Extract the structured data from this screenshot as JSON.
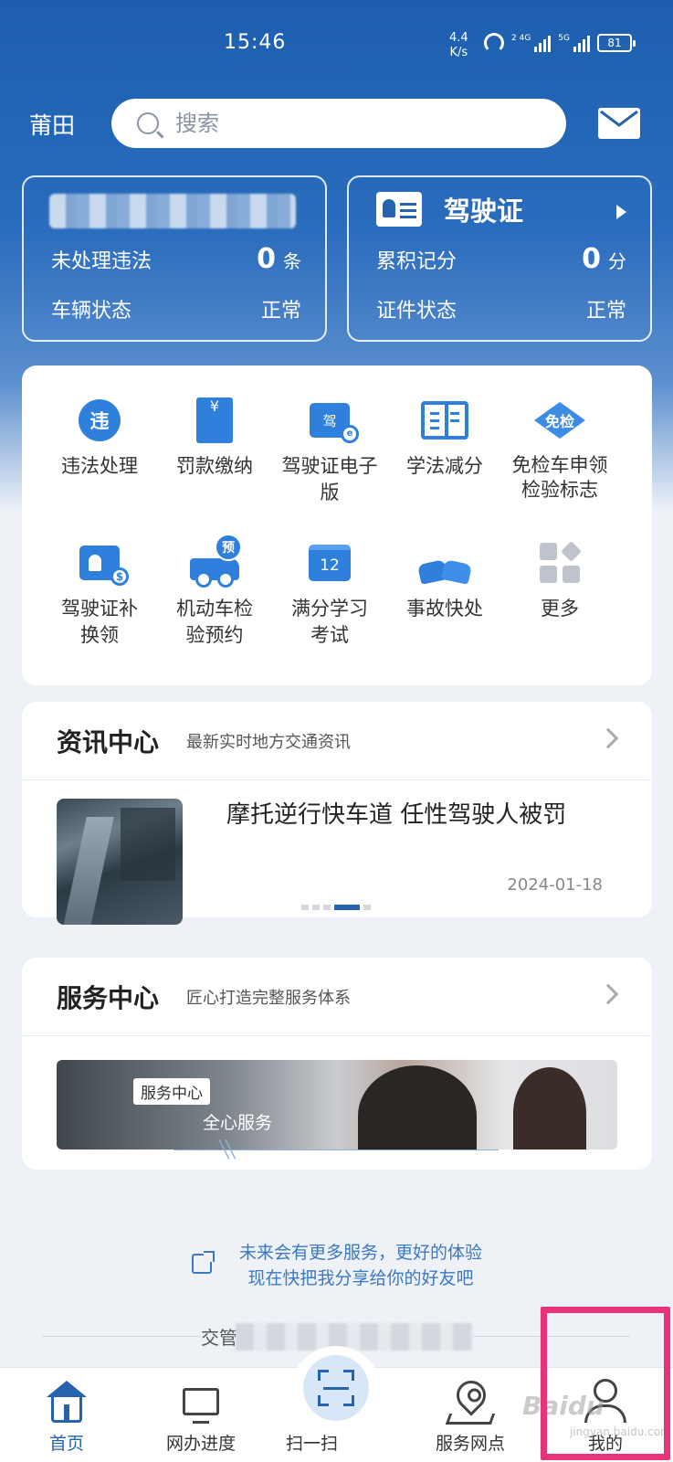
{
  "status_bar": {
    "time": "15:46",
    "speed": "4.4",
    "speed_unit": "K/s",
    "sig1_label": "2 4G",
    "sig2_label": "5G",
    "battery": "81"
  },
  "header": {
    "city": "莆田",
    "search_placeholder": "搜索",
    "mail_icon": "mail-icon"
  },
  "vehicle_card": {
    "violations_label": "未处理违法",
    "violations_count": "0",
    "violations_unit": "条",
    "status_label": "车辆状态",
    "status_value": "正常"
  },
  "license_card": {
    "title": "驾驶证",
    "points_label": "累积记分",
    "points_value": "0",
    "points_unit": "分",
    "status_label": "证件状态",
    "status_value": "正常"
  },
  "services": {
    "items": [
      {
        "label": "违法处理",
        "icon_text": "违"
      },
      {
        "label": "罚款缴纳",
        "icon_text": "¥"
      },
      {
        "label": "驾驶证电子版",
        "icon_text": "驾"
      },
      {
        "label": "学法减分",
        "icon_text": ""
      },
      {
        "label": "免检车申领检验标志",
        "icon_text": "免检"
      },
      {
        "label": "驾驶证补换领",
        "icon_text": ""
      },
      {
        "label": "机动车检验预约",
        "icon_text": "预"
      },
      {
        "label": "满分学习考试",
        "icon_text": "12"
      },
      {
        "label": "事故快处",
        "icon_text": ""
      },
      {
        "label": "更多",
        "icon_text": ""
      }
    ]
  },
  "news": {
    "title": "资讯中心",
    "subtitle": "最新实时地方交通资讯",
    "headline": "摩托逆行快车道 任性驾驶人被罚",
    "date": "2024-01-18"
  },
  "service_center": {
    "title": "服务中心",
    "subtitle": "匠心打造完整服务体系",
    "banner_tag": "服务中心",
    "banner_text": "全心服务"
  },
  "share": {
    "line1": "未来会有更多服务，更好的体验",
    "line2": "现在快把我分享给你的好友吧"
  },
  "footer": {
    "text": "交管"
  },
  "tabbar": {
    "tabs": [
      {
        "label": "首页"
      },
      {
        "label": "网办进度"
      },
      {
        "label": "扫一扫"
      },
      {
        "label": "服务网点"
      },
      {
        "label": "我的"
      }
    ]
  },
  "watermark": {
    "text": "Baidu",
    "sub": "jingyan.baidu.com"
  },
  "colors": {
    "brand": "#2563ae",
    "highlight": "#e8337a"
  }
}
